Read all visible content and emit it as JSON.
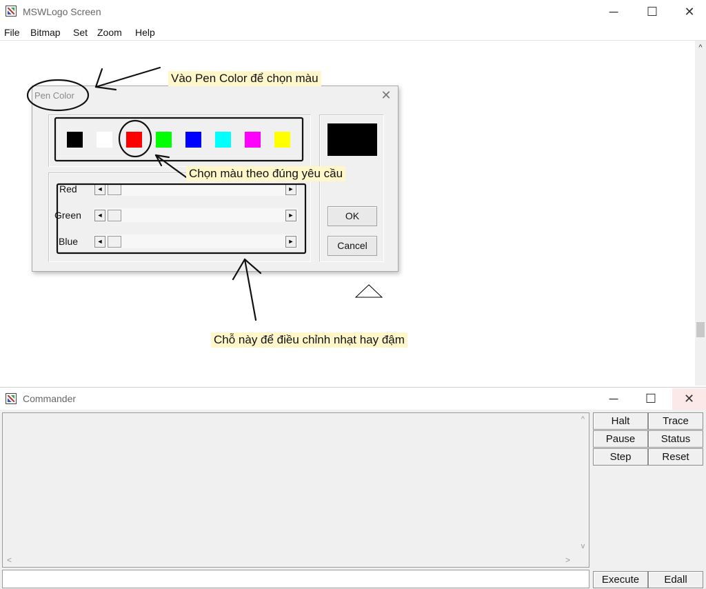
{
  "main_window": {
    "title": "MSWLogo Screen",
    "controls": {
      "minimize": "─",
      "maximize": "☐",
      "close": "✕"
    },
    "menu": [
      "File",
      "Bitmap",
      "Set",
      "Zoom",
      "Help"
    ]
  },
  "pen_color_dialog": {
    "title": "Pen Color",
    "close": "✕",
    "swatches": [
      {
        "color": "#000000",
        "selected": false
      },
      {
        "color": "#ffffff",
        "selected": false
      },
      {
        "color": "#ff0000",
        "selected": true
      },
      {
        "color": "#00ff00",
        "selected": false
      },
      {
        "color": "#0000ff",
        "selected": false
      },
      {
        "color": "#00ffff",
        "selected": false
      },
      {
        "color": "#ff00ff",
        "selected": false
      },
      {
        "color": "#ffff00",
        "selected": false
      }
    ],
    "preview_color": "#000000",
    "sliders": [
      {
        "label": "Red",
        "value": 0
      },
      {
        "label": "Green",
        "value": 0
      },
      {
        "label": "Blue",
        "value": 0
      }
    ],
    "ok_label": "OK",
    "cancel_label": "Cancel"
  },
  "annotations": {
    "pen_color_note": "Vào Pen Color để chọn màu",
    "choose_color_note": "Chọn màu theo đúng yêu cầu",
    "adjust_note": "Chỗ này để điều chỉnh nhạt hay đậm"
  },
  "commander": {
    "title": "Commander",
    "controls": {
      "minimize": "─",
      "maximize": "☐",
      "close": "✕"
    },
    "buttons": {
      "halt": "Halt",
      "trace": "Trace",
      "pause": "Pause",
      "status": "Status",
      "step": "Step",
      "reset": "Reset",
      "execute": "Execute",
      "edall": "Edall"
    },
    "input_value": ""
  },
  "icons": {
    "scroll_up": "^",
    "scroll_down": "v",
    "scroll_left": "<",
    "scroll_right": ">",
    "slider_left": "◄",
    "slider_right": "►"
  }
}
